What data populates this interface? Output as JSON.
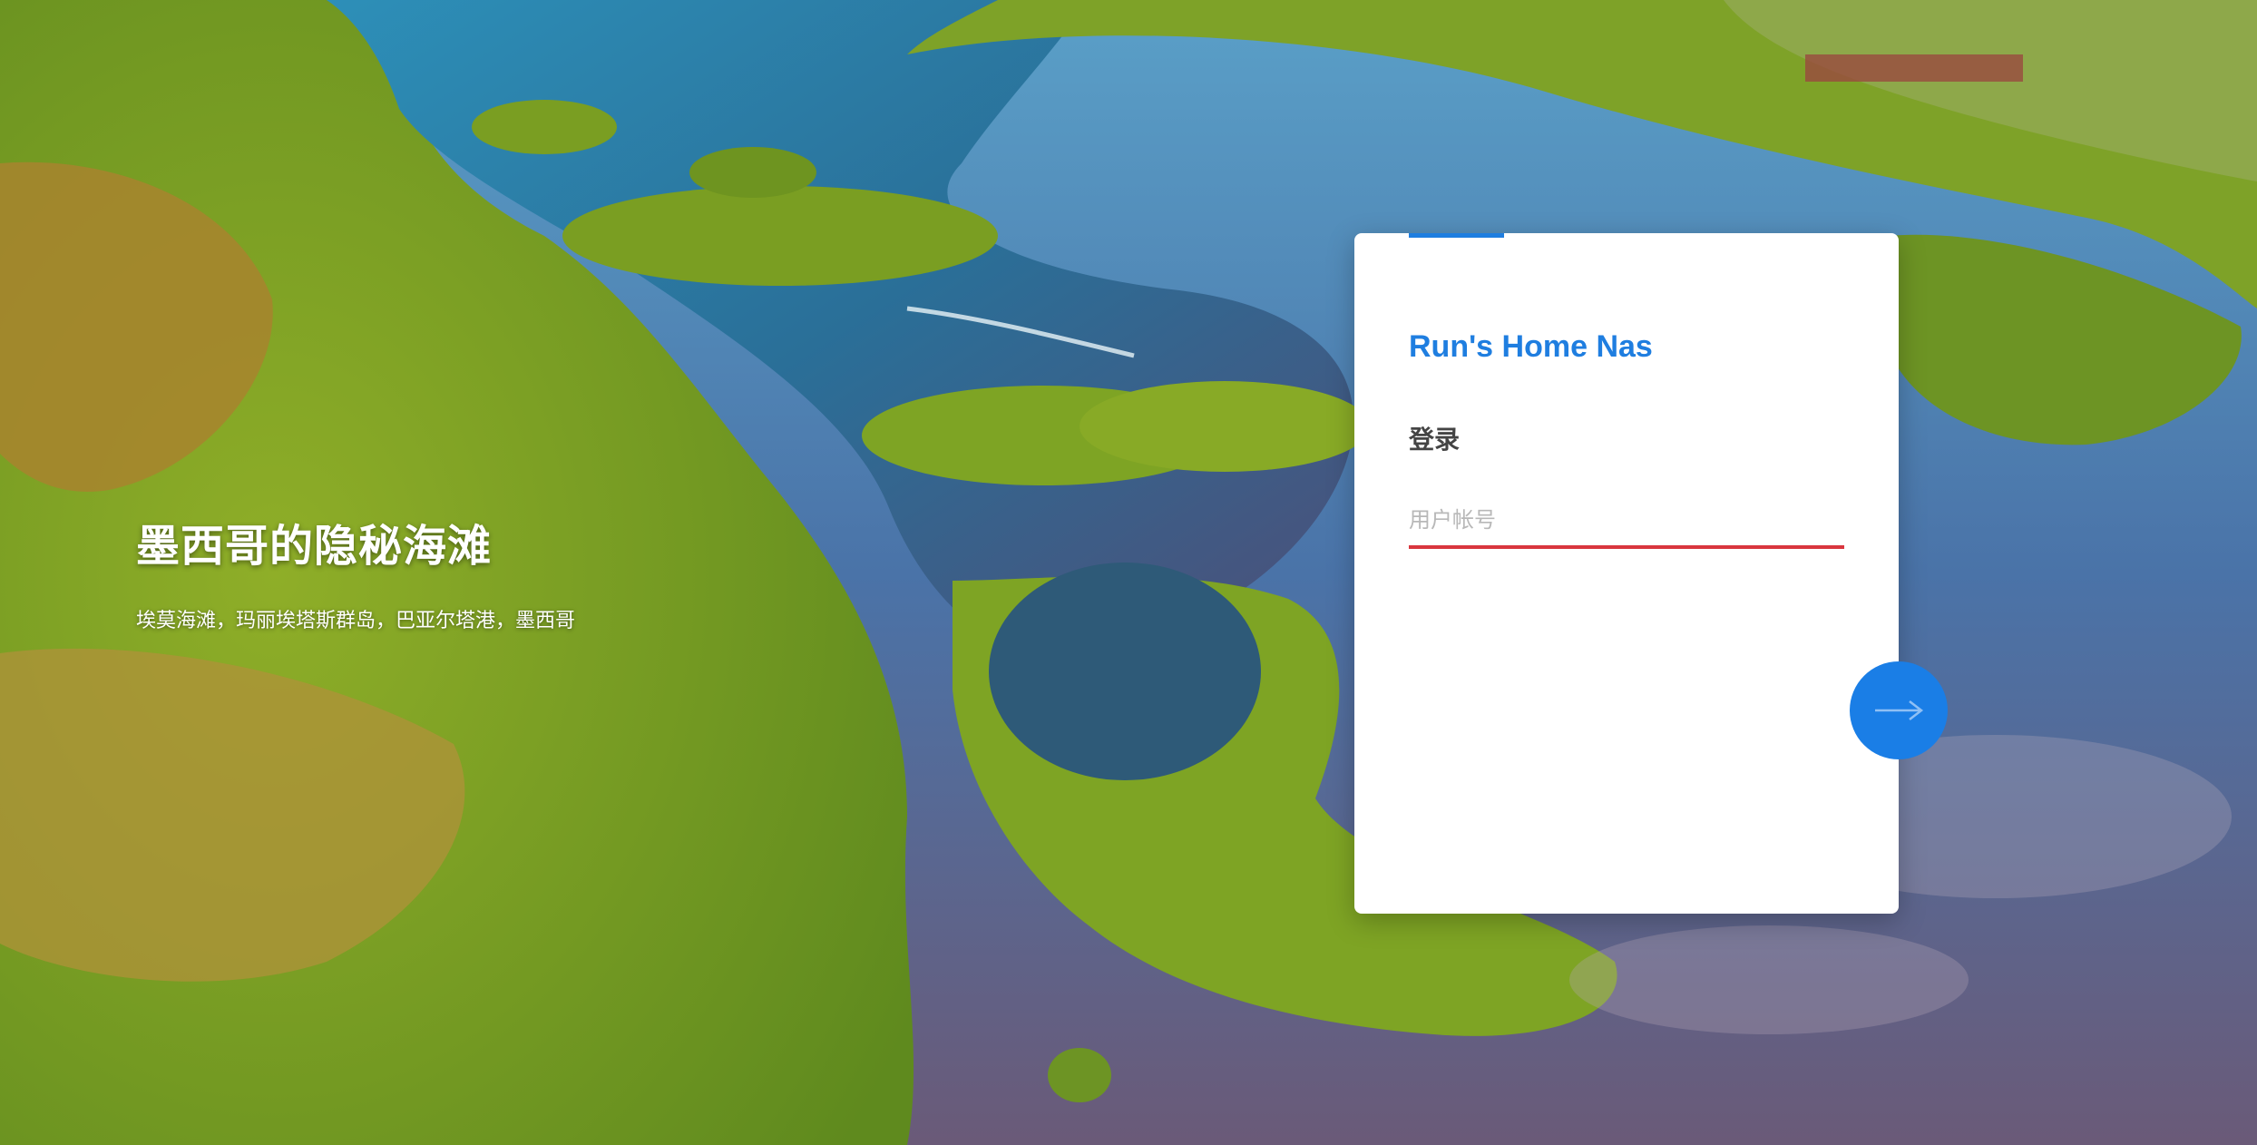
{
  "background": {
    "description_icon": "aerial-landscape-image"
  },
  "caption": {
    "title": "墨西哥的隐秘海滩",
    "subtitle": "埃莫海滩，玛丽埃塔斯群岛，巴亚尔塔港，墨西哥"
  },
  "login": {
    "app_title": "Run's Home Nas",
    "heading": "登录",
    "username_placeholder": "用户帐号",
    "username_value": "",
    "next_icon": "arrow-right-icon"
  },
  "colors": {
    "accent": "#1f7ee0",
    "button": "#1a7ee6",
    "input_underline": "#d9363e"
  }
}
